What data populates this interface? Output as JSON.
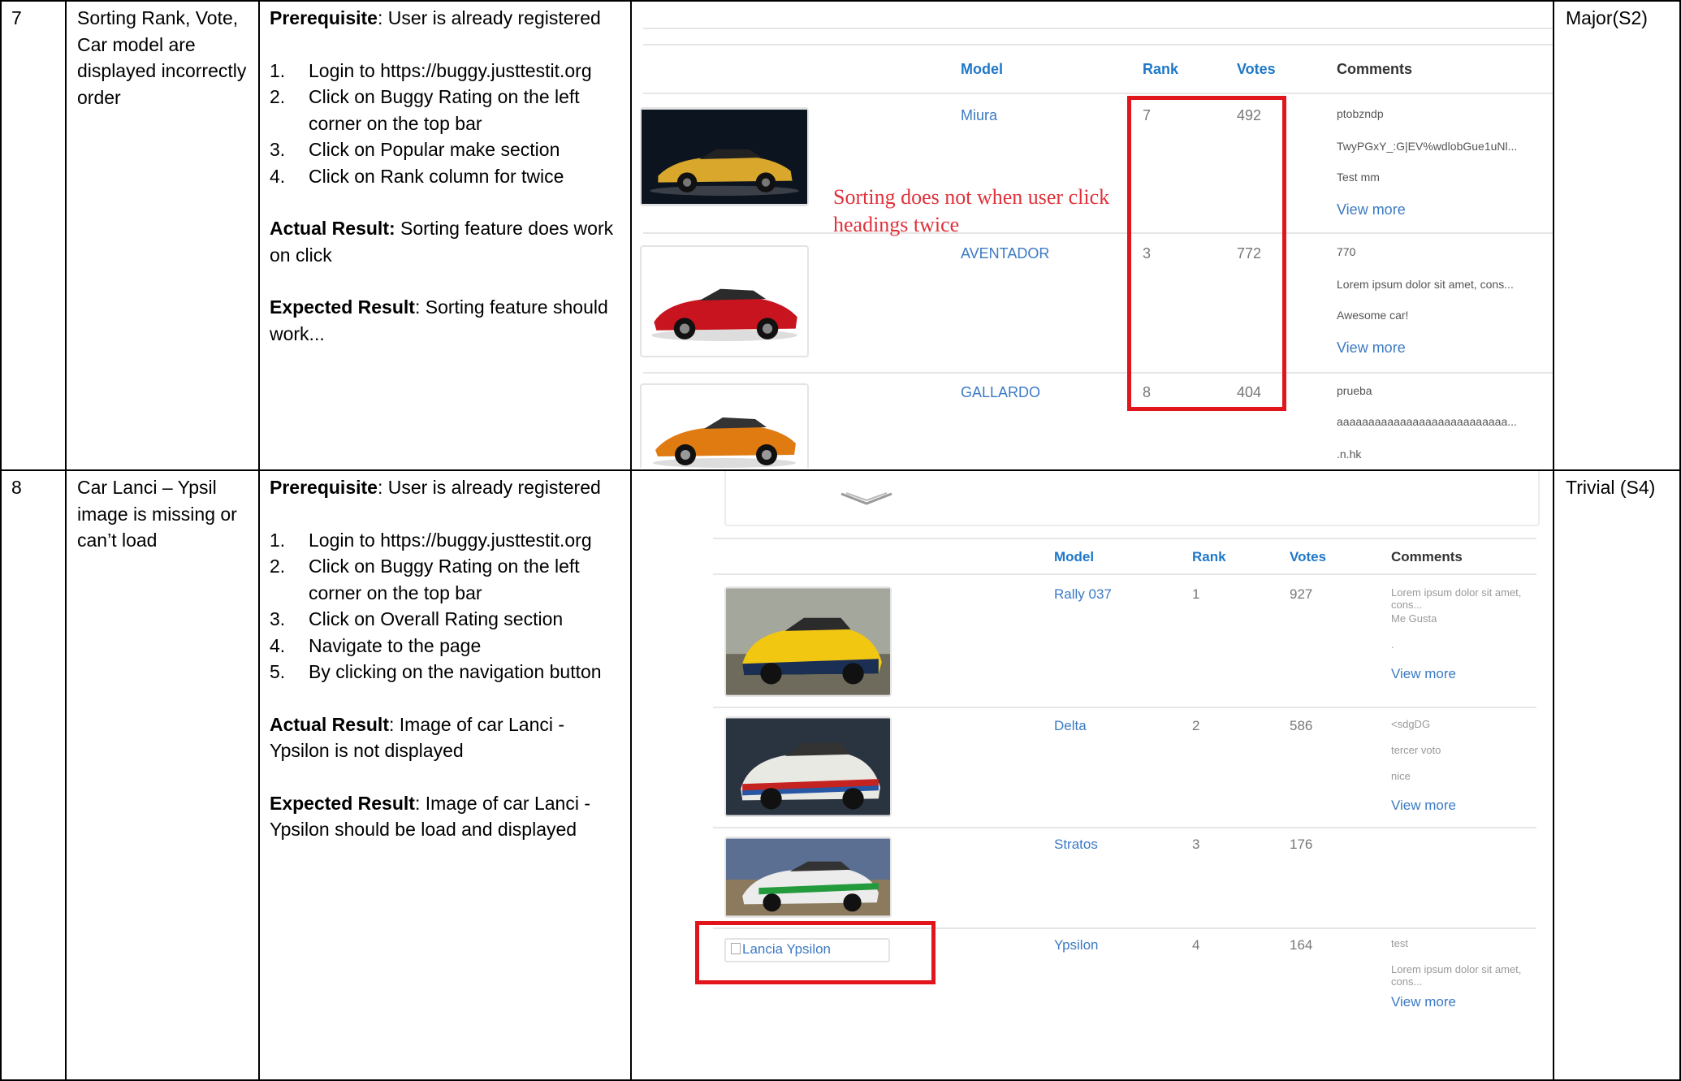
{
  "rows": [
    {
      "no": "7",
      "title": "Sorting Rank, Vote, Car model are displayed incorrectly order",
      "prereq_label": "Prerequisite",
      "prereq_text": ": User is already registered",
      "steps": [
        {
          "n": "1.",
          "text": "Login to https://buggy.justtestit.org"
        },
        {
          "n": "2.",
          "text": "Click on Buggy Rating on the left corner on the top bar"
        },
        {
          "n": "3.",
          "text": "Click on Popular make section"
        },
        {
          "n": "4.",
          "text": "Click on Rank column for twice"
        }
      ],
      "actual_label": "Actual Result:",
      "actual_text": " Sorting feature does work on click",
      "expected_label": "Expected Result",
      "expected_text": ": Sorting feature should work...",
      "severity": "Major(S2)",
      "screenshot": {
        "headers": {
          "model": "Model",
          "rank": "Rank",
          "votes": "Votes",
          "comments": "Comments"
        },
        "annotation_line1": "Sorting does not when user click",
        "annotation_line2": "headings twice",
        "cars": [
          {
            "model": "Miura",
            "rank": "7",
            "votes": "492",
            "comments": [
              "ptobzndp",
              "TwyPGxY_:G|EV%wdlobGue1uNl...",
              "Test mm"
            ],
            "view_more": "View more",
            "color": "#d9a72b"
          },
          {
            "model": "AVENTADOR",
            "rank": "3",
            "votes": "772",
            "comments": [
              "770",
              "Lorem ipsum dolor sit amet, cons...",
              "Awesome car!"
            ],
            "view_more": "View more",
            "color": "#c8141e"
          },
          {
            "model": "GALLARDO",
            "rank": "8",
            "votes": "404",
            "comments": [
              "prueba",
              "aaaaaaaaaaaaaaaaaaaaaaaaaaa...",
              ".n.hk"
            ],
            "view_more": "",
            "color": "#e07b12"
          }
        ]
      }
    },
    {
      "no": "8",
      "title": "Car Lanci – Ypsil image is missing or can’t load",
      "prereq_label": "Prerequisite",
      "prereq_text": ": User is already registered",
      "steps": [
        {
          "n": "1.",
          "text": "Login to https://buggy.justtestit.org"
        },
        {
          "n": "2.",
          "text": "Click on Buggy Rating on the left corner on the top bar"
        },
        {
          "n": "3.",
          "text": "Click on Overall Rating section"
        },
        {
          "n": "4.",
          "text": "Navigate to the page"
        },
        {
          "n": "5.",
          "text": "By clicking on the navigation button"
        }
      ],
      "actual_label": "Actual Result",
      "actual_text": ": Image of car Lanci - Ypsilon is not displayed",
      "expected_label": "Expected Result",
      "expected_text": ": Image of car Lanci - Ypsilon should be load and displayed",
      "severity": "Trivial (S4)",
      "screenshot": {
        "headers": {
          "model": "Model",
          "rank": "Rank",
          "votes": "Votes",
          "comments": "Comments"
        },
        "cars": [
          {
            "model": "Rally 037",
            "rank": "1",
            "votes": "927",
            "comments": [
              "Lorem ipsum dolor sit amet, cons...",
              "Me Gusta",
              "."
            ],
            "view_more": "View more"
          },
          {
            "model": "Delta",
            "rank": "2",
            "votes": "586",
            "comments": [
              "<sdgDG",
              "tercer voto",
              "nice"
            ],
            "view_more": "View more"
          },
          {
            "model": "Stratos",
            "rank": "3",
            "votes": "176",
            "comments": [],
            "view_more": ""
          },
          {
            "model": "Ypsilon",
            "rank": "4",
            "votes": "164",
            "comments": [
              "test",
              "Lorem ipsum dolor sit amet, cons..."
            ],
            "view_more": "View more",
            "broken_alt": "Lancia Ypsilon"
          }
        ]
      }
    }
  ]
}
